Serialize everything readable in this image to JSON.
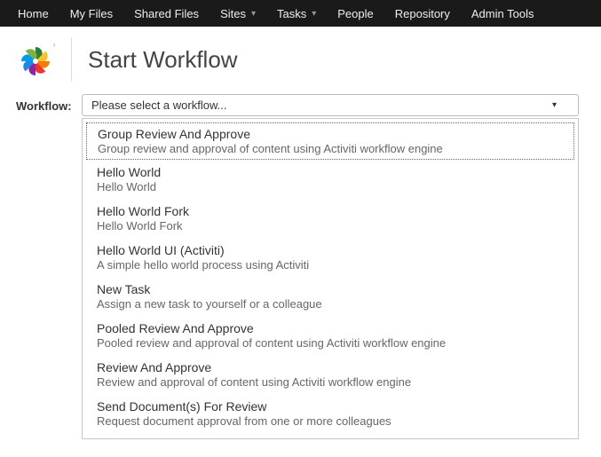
{
  "nav": {
    "items": [
      {
        "label": "Home",
        "dropdown": false
      },
      {
        "label": "My Files",
        "dropdown": false
      },
      {
        "label": "Shared Files",
        "dropdown": false
      },
      {
        "label": "Sites",
        "dropdown": true
      },
      {
        "label": "Tasks",
        "dropdown": true
      },
      {
        "label": "People",
        "dropdown": false
      },
      {
        "label": "Repository",
        "dropdown": false
      },
      {
        "label": "Admin Tools",
        "dropdown": false
      }
    ]
  },
  "page": {
    "title": "Start Workflow"
  },
  "workflow": {
    "label": "Workflow:",
    "placeholder": "Please select a workflow...",
    "options": [
      {
        "title": "Group Review And Approve",
        "desc": "Group review and approval of content using Activiti workflow engine"
      },
      {
        "title": "Hello World",
        "desc": "Hello World"
      },
      {
        "title": "Hello World Fork",
        "desc": "Hello World Fork"
      },
      {
        "title": "Hello World UI (Activiti)",
        "desc": "A simple hello world process using Activiti"
      },
      {
        "title": "New Task",
        "desc": "Assign a new task to yourself or a colleague"
      },
      {
        "title": "Pooled Review And Approve",
        "desc": "Pooled review and approval of content using Activiti workflow engine"
      },
      {
        "title": "Review And Approve",
        "desc": "Review and approval of content using Activiti workflow engine"
      },
      {
        "title": "Send Document(s) For Review",
        "desc": "Request document approval from one or more colleagues"
      }
    ]
  }
}
